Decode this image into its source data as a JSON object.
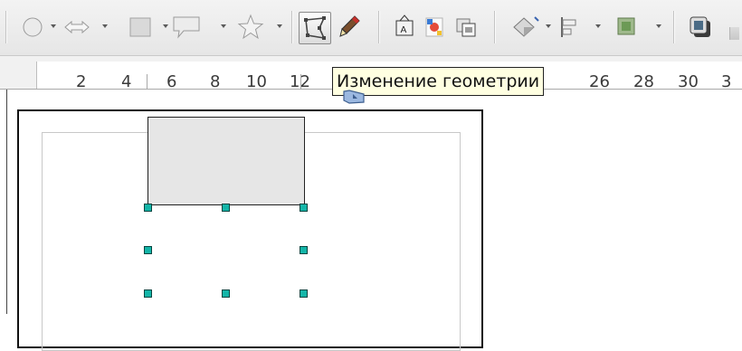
{
  "toolbar": {
    "tooltip": "Изменение геометрии",
    "icons": [
      "smiley-icon",
      "double-arrow-icon",
      "rectangle-icon",
      "callout-icon",
      "star-icon",
      "edit-points-icon",
      "pen-icon",
      "text-frame-icon",
      "fontwork-icon",
      "image-icon",
      "3d-icon",
      "align-icon",
      "arrange-icon",
      "shadow-icon",
      "more-icon"
    ]
  },
  "ruler": {
    "labels": [
      "2",
      "4",
      "6",
      "8",
      "10",
      "12",
      "26",
      "28",
      "30",
      "3"
    ]
  },
  "colors": {
    "handle": "#13b5a8",
    "shape_fill": "#e6e6e6",
    "tooltip_bg": "#ffffe1"
  }
}
